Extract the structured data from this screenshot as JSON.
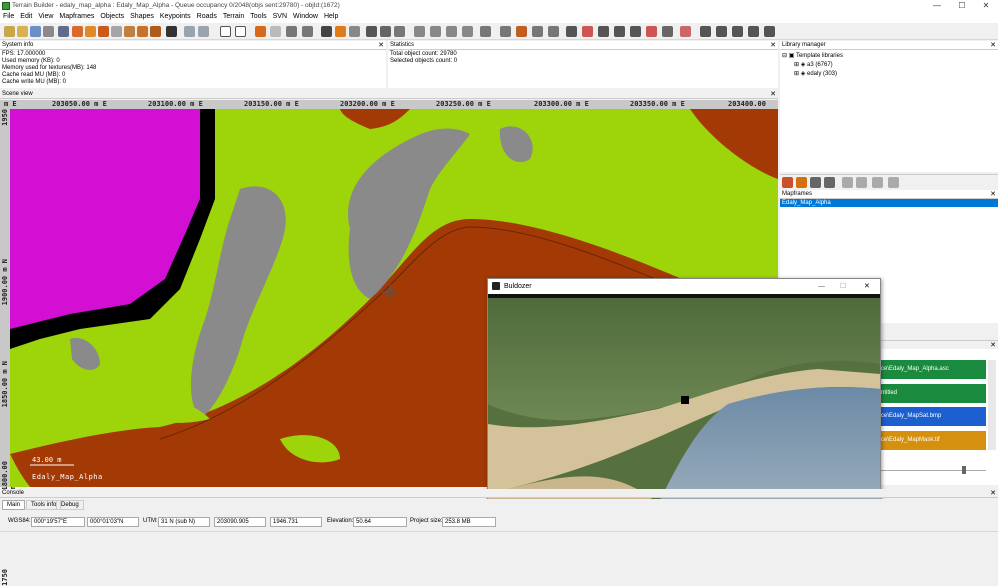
{
  "window": {
    "title": "Terrain Builder - edaly_map_alpha : Edaly_Map_Alpha - Queue occupancy 0/2048(objs sent:29780) - objId:(1672)",
    "minimize": "—",
    "maximize": "☐",
    "close": "✕"
  },
  "menu": [
    "File",
    "Edit",
    "View",
    "Mapframes",
    "Objects",
    "Shapes",
    "Keypoints",
    "Roads",
    "Terrain",
    "Tools",
    "SVN",
    "Window",
    "Help"
  ],
  "system_info": {
    "header": "System info",
    "lines": [
      "FPS: 17.000000",
      "Used memory (KB): 0",
      "Memory used for textures(MB): 148",
      "Cache read MU (MB): 0",
      "Cache write MU (MB): 0"
    ]
  },
  "statistics": {
    "header": "Statistics",
    "lines": [
      "Total object count: 29780",
      "Selected objects count: 0"
    ]
  },
  "library_manager": {
    "header": "Library manager",
    "root": "Template libraries",
    "items": [
      "a3 (6767)",
      "edaly (303)"
    ]
  },
  "mapframes": {
    "header": "Mapframes",
    "selected": "Edaly_Map_Alpha"
  },
  "layers": [
    {
      "label": "ce\\Edaly_Map_Alpha.asc",
      "color": "#1a8a3f"
    },
    {
      "label": "ntitled",
      "color": "#1a8a3f"
    },
    {
      "label": "ce\\Edaly_MapSat.bmp",
      "color": "#1c5fd0"
    },
    {
      "label": "ce\\Edaly_MapMask.tif",
      "color": "#d4900e"
    }
  ],
  "scene_view": {
    "header": "Scene view",
    "hruler": [
      "203050.00 m E",
      "203100.00 m E",
      "203150.00 m E",
      "203200.00 m E",
      "203250.00 m E",
      "203300.00 m E",
      "203350.00 m E",
      "203400.00"
    ],
    "vruler": [
      "1950",
      "1900.00 m N",
      "1850.00 m N",
      "1800.00 m N",
      "1750"
    ],
    "scale_label": "43.00 m",
    "map_label": "Edaly_Map_Alpha",
    "colors": {
      "grass": "#9dd50a",
      "soil": "#a33a06",
      "rock": "#8a8a8a",
      "purple": "#d30fd4",
      "black": "#000000"
    }
  },
  "bulldozer": {
    "title": "Buldozer",
    "minimize": "—",
    "maximize": "☐",
    "close": "✕"
  },
  "console": {
    "header": "Console",
    "tabs": [
      "Main",
      "Tools info",
      "Debug"
    ]
  },
  "status": {
    "wgs_label": "WGS84:",
    "lon": "000°19'57\"E",
    "lat": "000°01'03\"N",
    "utm_label": "UTM:",
    "zone": "31 N (sub N)",
    "easting": "203090.905",
    "northing": "1946.731",
    "elev_label": "Elevation:",
    "elevation": "50.64",
    "size_label": "Project size:",
    "size": "253.8 MB"
  }
}
